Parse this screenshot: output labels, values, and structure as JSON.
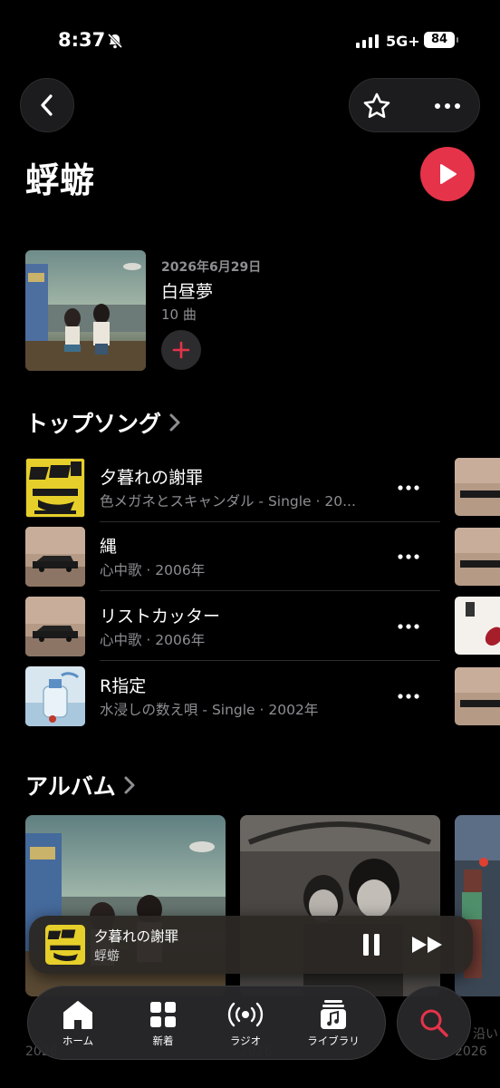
{
  "status_bar": {
    "time": "8:37",
    "network": "5G+",
    "battery": "84"
  },
  "artist": {
    "name": "蜉蝣"
  },
  "latest_release": {
    "date": "2026年6月29日",
    "title": "白昼夢",
    "track_count": "10 曲"
  },
  "top_songs": {
    "header": "トップソング",
    "items": [
      {
        "title": "夕暮れの謝罪",
        "subtitle": "色メガネとスキャンダル - Single · 20..."
      },
      {
        "title": "縄",
        "subtitle": "心中歌 · 2006年"
      },
      {
        "title": "リストカッター",
        "subtitle": "心中歌 · 2006年"
      },
      {
        "title": "R指定",
        "subtitle": "水浸しの数え唄 - Single · 2002年"
      }
    ]
  },
  "albums": {
    "header": "アルバム",
    "peek_texts": [
      "2026",
      "2026",
      "沿い",
      "2026"
    ]
  },
  "now_playing": {
    "title": "夕暮れの謝罪",
    "artist": "蜉蝣"
  },
  "tab_bar": {
    "tabs": [
      {
        "label": "ホーム",
        "icon": "home-icon"
      },
      {
        "label": "新着",
        "icon": "grid-icon"
      },
      {
        "label": "ラジオ",
        "icon": "radio-icon"
      },
      {
        "label": "ライブラリ",
        "icon": "library-icon"
      }
    ],
    "search_icon": "search-icon"
  },
  "colors": {
    "accent": "#e5334a",
    "background": "#000000",
    "secondary_text": "#8e8e93"
  }
}
